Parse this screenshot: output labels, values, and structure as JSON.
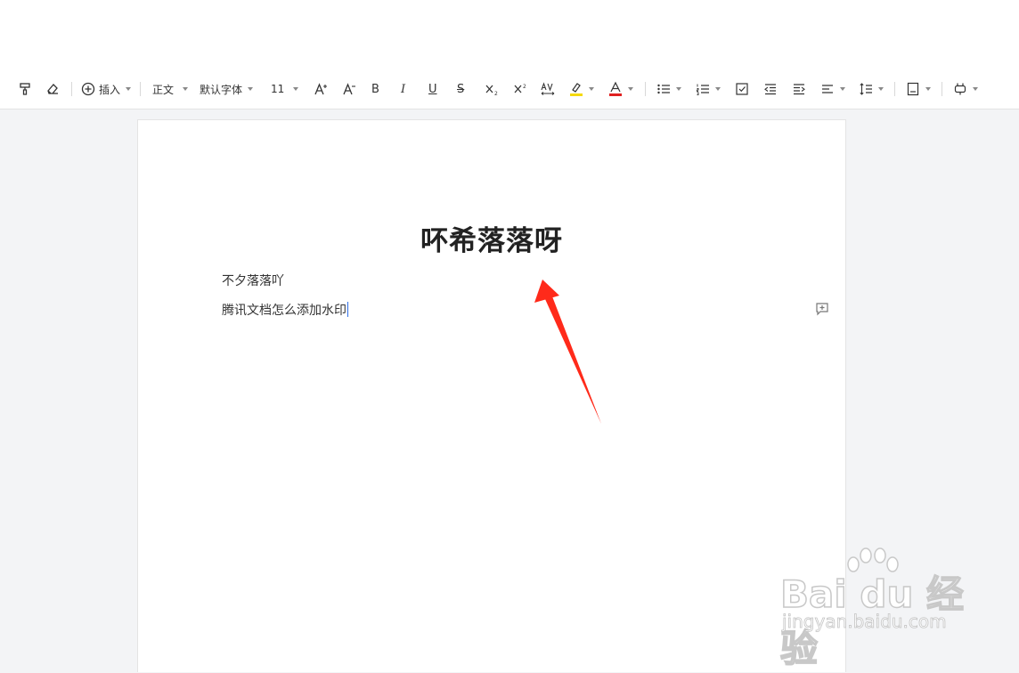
{
  "toolbar": {
    "insert_label": "插入",
    "style_label": "正文",
    "font_label": "默认字体",
    "size_label": "11",
    "bold_glyph": "B",
    "italic_glyph": "I",
    "underline_glyph": "U",
    "strike_glyph": "S",
    "highlight_color": "#f5d90a",
    "font_color": "#e02020"
  },
  "document": {
    "title": "吥希落落呀",
    "paragraphs": [
      "不夕落落吖",
      "腾讯文档怎么添加水印"
    ]
  },
  "annotation": {
    "arrow_color": "#ff2a1a"
  },
  "watermark": {
    "logo": "Bai du 经验",
    "url": "jingyan.baidu.com"
  }
}
